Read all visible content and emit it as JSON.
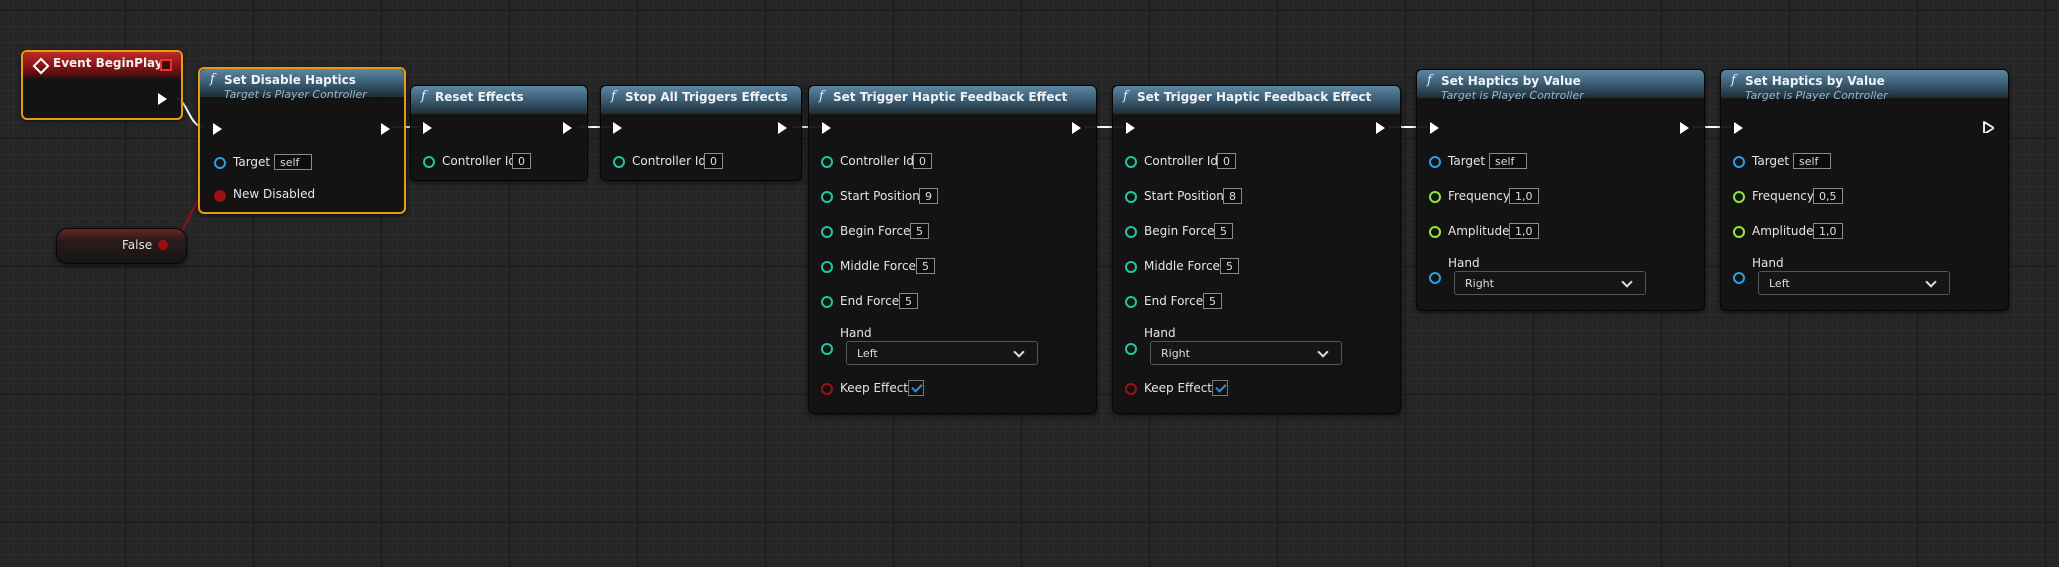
{
  "colors": {
    "function_header": "#3d6179",
    "event_header": "#8e1515",
    "selection": "#e99a13",
    "exec_wire": "#ffffff",
    "bool_wire": "#9a1010"
  },
  "nodes": {
    "begin_play": {
      "title": "Event BeginPlay"
    },
    "false_literal": {
      "label": "False"
    },
    "set_disable_haptics": {
      "icon": "f",
      "title": "Set Disable Haptics",
      "subtitle": "Target is Player Controller",
      "target_label": "Target",
      "target_value": "self",
      "new_disabled_label": "New Disabled"
    },
    "reset_effects": {
      "icon": "f",
      "title": "Reset Effects",
      "controller_id_label": "Controller Id",
      "controller_id_value": "0"
    },
    "stop_all_triggers": {
      "icon": "f",
      "title": "Stop All Triggers Effects",
      "controller_id_label": "Controller Id",
      "controller_id_value": "0"
    },
    "trigger_left": {
      "icon": "f",
      "title": "Set Trigger Haptic Feedback Effect",
      "controller_id_label": "Controller Id",
      "controller_id_value": "0",
      "start_position_label": "Start Position",
      "start_position_value": "9",
      "begin_force_label": "Begin Force",
      "begin_force_value": "5",
      "middle_force_label": "Middle Force",
      "middle_force_value": "5",
      "end_force_label": "End Force",
      "end_force_value": "5",
      "hand_label": "Hand",
      "hand_value": "Left",
      "keep_effect_label": "Keep Effect",
      "keep_effect_checked": true
    },
    "trigger_right": {
      "icon": "f",
      "title": "Set Trigger Haptic Feedback Effect",
      "controller_id_label": "Controller Id",
      "controller_id_value": "0",
      "start_position_label": "Start Position",
      "start_position_value": "8",
      "begin_force_label": "Begin Force",
      "begin_force_value": "5",
      "middle_force_label": "Middle Force",
      "middle_force_value": "5",
      "end_force_label": "End Force",
      "end_force_value": "5",
      "hand_label": "Hand",
      "hand_value": "Right",
      "keep_effect_label": "Keep Effect",
      "keep_effect_checked": true
    },
    "haptics_right": {
      "icon": "f",
      "title": "Set Haptics by Value",
      "subtitle": "Target is Player Controller",
      "target_label": "Target",
      "target_value": "self",
      "frequency_label": "Frequency",
      "frequency_value": "1,0",
      "amplitude_label": "Amplitude",
      "amplitude_value": "1,0",
      "hand_label": "Hand",
      "hand_value": "Right"
    },
    "haptics_left": {
      "icon": "f",
      "title": "Set Haptics by Value",
      "subtitle": "Target is Player Controller",
      "target_label": "Target",
      "target_value": "self",
      "frequency_label": "Frequency",
      "frequency_value": "0,5",
      "amplitude_label": "Amplitude",
      "amplitude_value": "1,0",
      "hand_label": "Hand",
      "hand_value": "Left"
    }
  }
}
